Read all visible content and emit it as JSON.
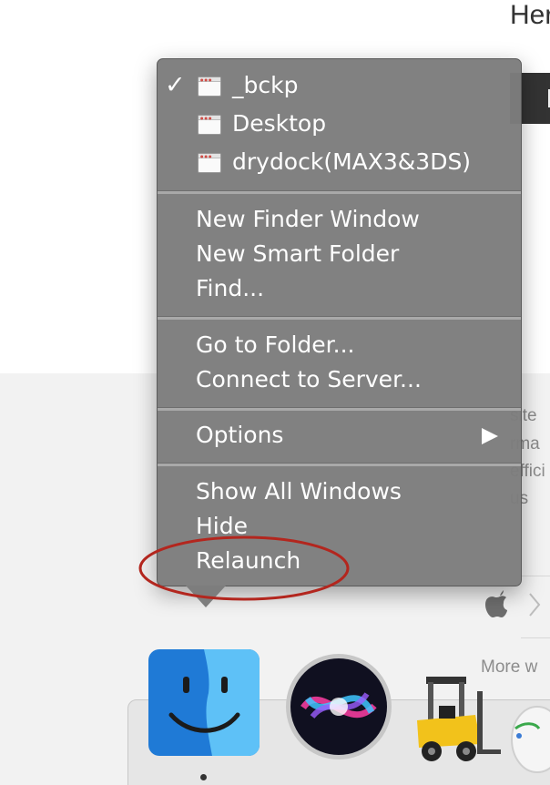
{
  "background": {
    "heading_fragment": "Her",
    "side_text_lines": [
      "site",
      "rma",
      "effici",
      "us"
    ],
    "more_link": "More w"
  },
  "menu": {
    "windows": [
      {
        "label": "_bckp",
        "checked": true
      },
      {
        "label": "Desktop",
        "checked": false
      },
      {
        "label": "drydock(MAX3&3DS)",
        "checked": false
      }
    ],
    "check_glyph": "✓",
    "items": {
      "new_finder_window": "New Finder Window",
      "new_smart_folder": "New Smart Folder",
      "find": "Find...",
      "go_to_folder": "Go to Folder...",
      "connect_to_server": "Connect to Server...",
      "options": "Options",
      "show_all_windows": "Show All Windows",
      "hide": "Hide",
      "relaunch": "Relaunch"
    }
  },
  "dock": {
    "items": [
      "finder-icon",
      "siri-icon",
      "forklift-icon",
      "mouse-icon"
    ],
    "running_indicator_under": "finder-icon"
  },
  "colors": {
    "menu_bg": "#7d7d7d",
    "menu_text": "#ffffff",
    "annotation": "#b3261e",
    "dock_bg": "#e6e6e6"
  }
}
